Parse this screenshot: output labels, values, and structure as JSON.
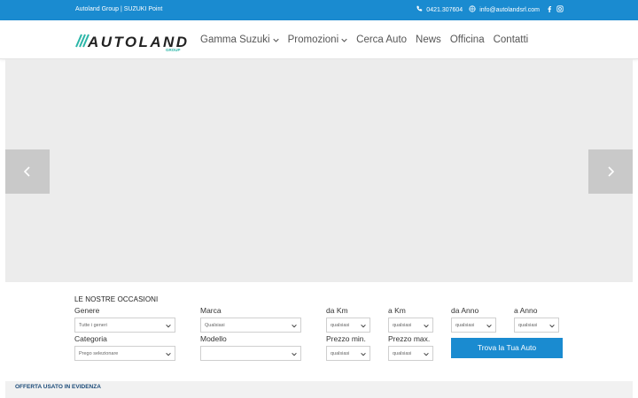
{
  "topbar": {
    "brand": "Autoland Group | SUZUKI Point",
    "phone": "0421.307604",
    "email": "info@autolandsrl.com"
  },
  "logo": {
    "main": "AUTOLAND",
    "sub": "GROUP",
    "accent_color": "#2bb6a8"
  },
  "nav": {
    "items": [
      {
        "label": "Gamma Suzuki",
        "dropdown": true
      },
      {
        "label": "Promozioni",
        "dropdown": true
      },
      {
        "label": "Cerca Auto",
        "dropdown": false
      },
      {
        "label": "News",
        "dropdown": false
      },
      {
        "label": "Officina",
        "dropdown": false
      },
      {
        "label": "Contatti",
        "dropdown": false
      }
    ]
  },
  "search": {
    "title": "LE NOSTRE OCCASIONI",
    "genere_label": "Genere",
    "genere_value": "Tutte i generi",
    "marca_label": "Marca",
    "marca_value": "Qualsiasi",
    "dakm_label": "da Km",
    "dakm_value": "qualsiasi",
    "akm_label": "a Km",
    "akm_value": "qualsiasi",
    "daanno_label": "da Anno",
    "daanno_value": "qualsiasi",
    "aanno_label": "a Anno",
    "aanno_value": "qualsiasi",
    "categoria_label": "Categoria",
    "categoria_value": "Prego selezionare",
    "modello_label": "Modello",
    "modello_value": "",
    "prezzomin_label": "Prezzo min.",
    "prezzomin_value": "qualsiasi",
    "prezzomax_label": "Prezzo max.",
    "prezzomax_value": "qualsiasi",
    "button": "Trova la Tua Auto"
  },
  "featured": {
    "title": "OFFERTA USATO IN EVIDENZA"
  },
  "colors": {
    "primary": "#1a8bd0",
    "hero_bg": "#ececec",
    "arrow_bg": "#c9c9c9"
  }
}
